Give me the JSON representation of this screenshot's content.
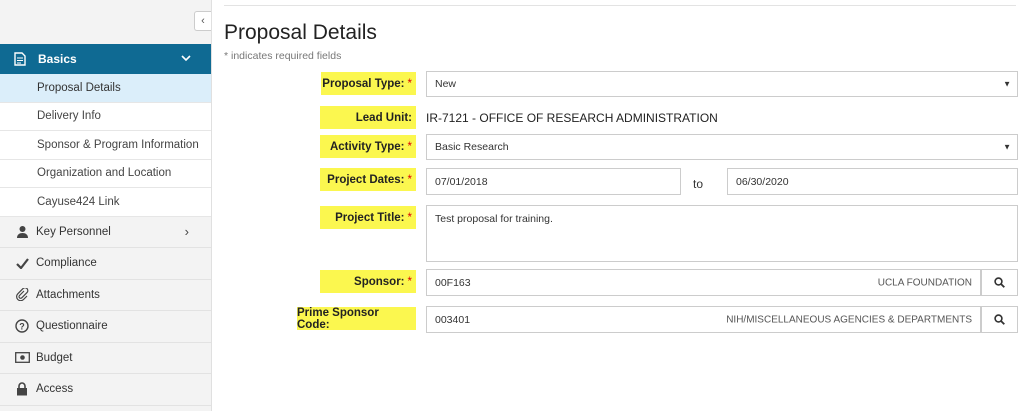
{
  "sidebar": {
    "section": {
      "label": "Basics",
      "icon": "document-icon"
    },
    "sub_items": [
      {
        "label": "Proposal Details",
        "active": true
      },
      {
        "label": "Delivery Info"
      },
      {
        "label": "Sponsor & Program Information"
      },
      {
        "label": "Organization and Location"
      },
      {
        "label": "Cayuse424 Link"
      }
    ],
    "items": [
      {
        "label": "Key Personnel",
        "icon": "person-icon"
      },
      {
        "label": "Compliance",
        "icon": "checkmark-icon"
      },
      {
        "label": "Attachments",
        "icon": "paperclip-icon"
      },
      {
        "label": "Questionnaire",
        "icon": "question-circle-icon"
      },
      {
        "label": "Budget",
        "icon": "money-icon"
      },
      {
        "label": "Access",
        "icon": "lock-icon"
      }
    ]
  },
  "page": {
    "title": "Proposal Details",
    "required_note": "* indicates required fields"
  },
  "form": {
    "proposal_type": {
      "label": "Proposal Type:",
      "required": "*",
      "value": "New"
    },
    "lead_unit": {
      "label": "Lead Unit:",
      "value": "IR-7121 - OFFICE OF RESEARCH ADMINISTRATION"
    },
    "activity_type": {
      "label": "Activity Type:",
      "required": "*",
      "value": "Basic Research"
    },
    "project_dates": {
      "label": "Project Dates:",
      "required": "*",
      "start": "07/01/2018",
      "separator": "to",
      "end": "06/30/2020"
    },
    "project_title": {
      "label": "Project Title:",
      "required": "*",
      "value": "Test proposal for training."
    },
    "sponsor": {
      "label": "Sponsor:",
      "required": "*",
      "code": "00F163",
      "name": "UCLA FOUNDATION"
    },
    "prime_sponsor": {
      "label": "Prime Sponsor Code:",
      "code": "003401",
      "name": "NIH/MISCELLANEOUS AGENCIES & DEPARTMENTS"
    }
  },
  "colors": {
    "nav_header": "#0f6a93",
    "active_item": "#dbeefa",
    "highlight": "#fbf74f",
    "required": "#dd0000"
  }
}
